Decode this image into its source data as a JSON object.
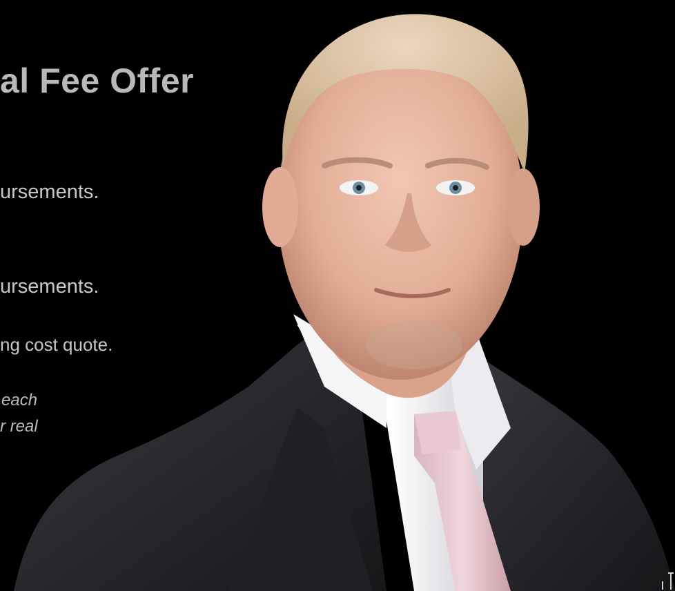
{
  "slide": {
    "heading": "al Fee Offer",
    "line1": "ursements.",
    "line2": "ursements.",
    "line3": "ng cost quote.",
    "note_line1": "each",
    "note_line2": "r real"
  },
  "photo": {
    "subject": "portrait-man-in-suit",
    "colors": {
      "background": "#000000",
      "suit": "#2b2b30",
      "shirt": "#f2f2f4",
      "tie": "#e3c7cf",
      "skin": "#e7b9a4",
      "hair": "#d9c3a6"
    }
  }
}
